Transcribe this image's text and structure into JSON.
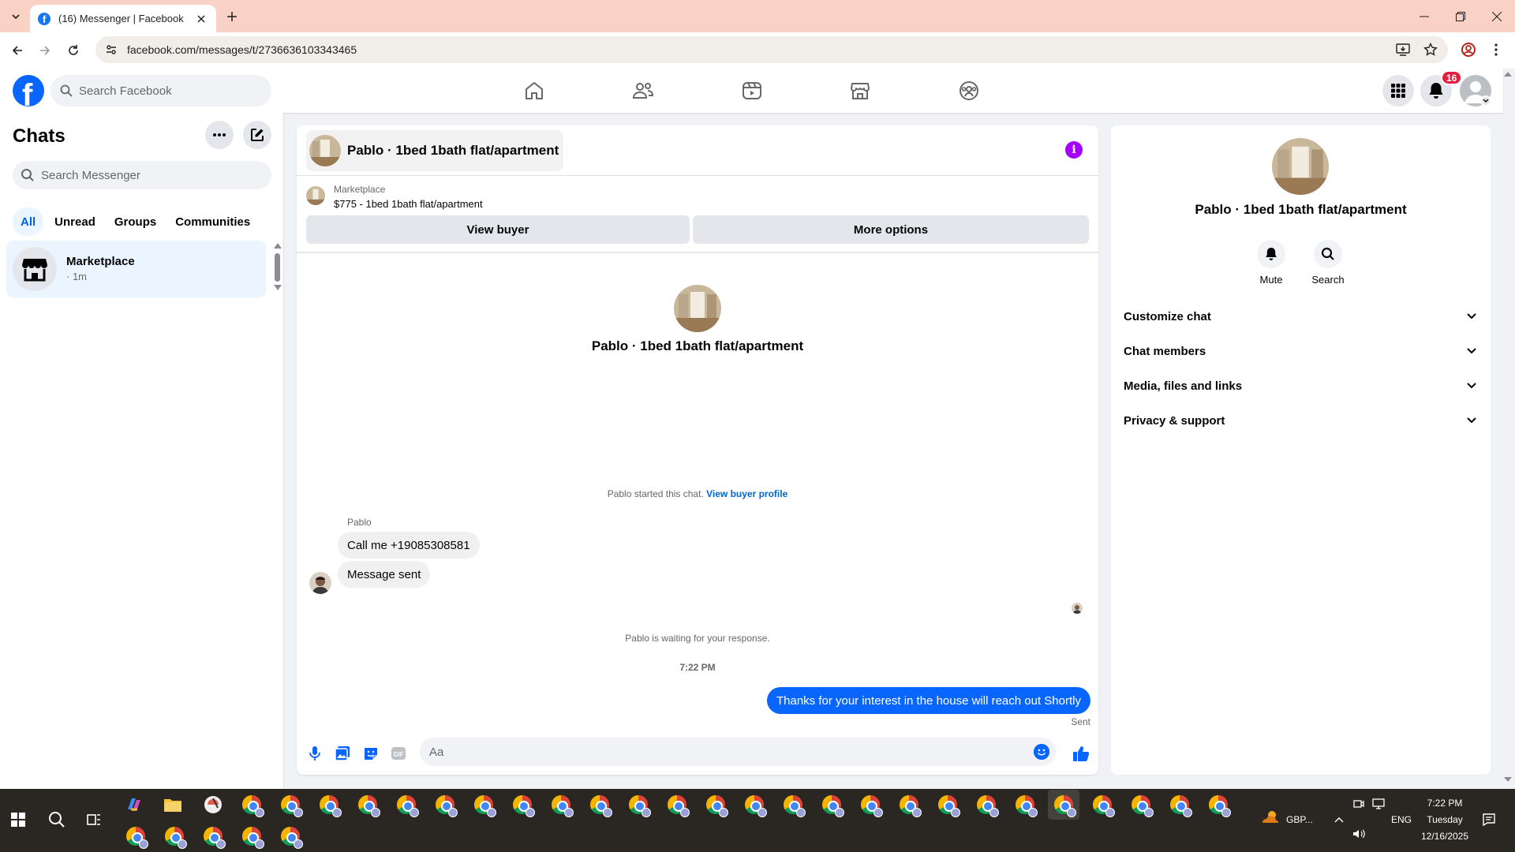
{
  "browser": {
    "tab_title": "(16) Messenger | Facebook",
    "url": "facebook.com/messages/t/2736636103343465"
  },
  "fb": {
    "logo_letter": "f",
    "search_placeholder": "Search Facebook",
    "notification_count": "16",
    "nav_icons": [
      "home-icon",
      "friends-icon",
      "video-icon",
      "marketplace-icon",
      "groups-icon"
    ]
  },
  "chats": {
    "title": "Chats",
    "search_placeholder": "Search Messenger",
    "filters": [
      "All",
      "Unread",
      "Groups",
      "Communities"
    ],
    "items": [
      {
        "name": "Marketplace",
        "time": "· 1m"
      }
    ]
  },
  "conversation": {
    "title": "Pablo · 1bed 1bath flat/apartment",
    "info_glyph": "i",
    "marketplace_label": "Marketplace",
    "listing": "$775 - 1bed 1bath flat/apartment",
    "view_buyer": "View buyer",
    "more_options": "More options",
    "intro_name": "Pablo · 1bed 1bath flat/apartment",
    "started_text": "Pablo started this chat.",
    "view_profile": "View buyer profile",
    "sender": "Pablo",
    "incoming": [
      "Call me +19085308581",
      "Message sent"
    ],
    "waiting": "Pablo is waiting for your response.",
    "timestamp": "7:22 PM",
    "outgoing": "Thanks for your interest in the house will reach out Shortly",
    "sent_status": "Sent",
    "composer_placeholder": "Aa"
  },
  "info_panel": {
    "name": "Pablo · 1bed 1bath flat/apartment",
    "actions": [
      "Mute",
      "Search"
    ],
    "sections": [
      "Customize chat",
      "Chat members",
      "Media, files and links",
      "Privacy & support"
    ]
  },
  "taskbar": {
    "weather": "GBP...",
    "lang": "ENG",
    "time": "7:22 PM",
    "day": "Tuesday",
    "date": "12/16/2025"
  },
  "colors": {
    "fb_blue": "#0866ff",
    "tab_strip": "#f9d1c5",
    "info_purple": "#a400ff",
    "badge_red": "#e41e3f"
  }
}
